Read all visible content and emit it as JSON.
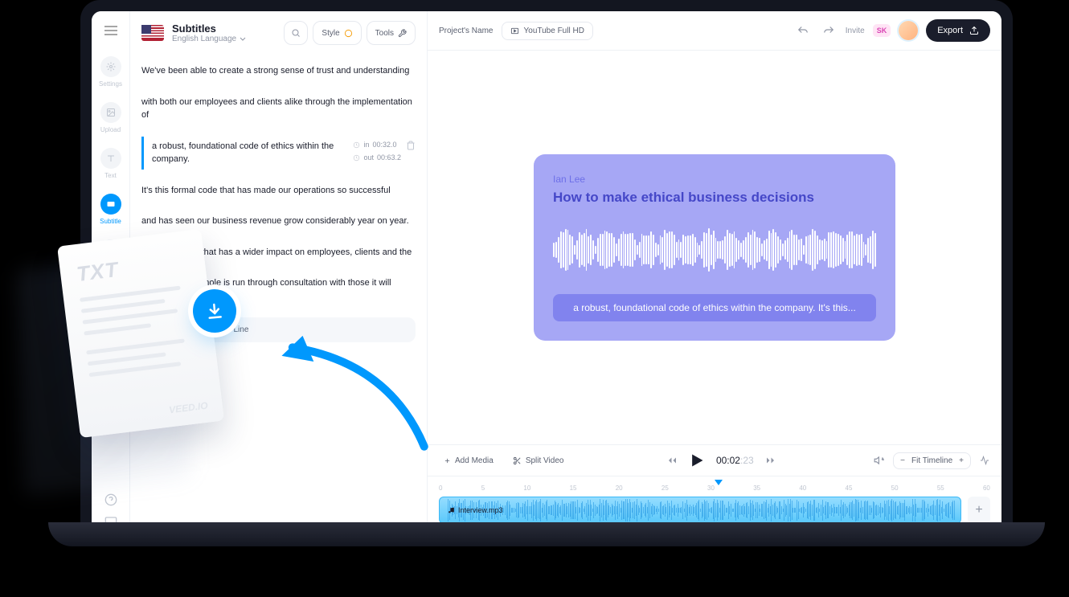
{
  "sidebar": {
    "items": [
      {
        "label": "Settings",
        "icon": "gear"
      },
      {
        "label": "Upload",
        "icon": "image"
      },
      {
        "label": "Text",
        "icon": "text"
      },
      {
        "label": "Subtitle",
        "icon": "subtitle",
        "active": true
      },
      {
        "label": "",
        "icon": "chat"
      }
    ]
  },
  "subtitles": {
    "title": "Subtitles",
    "language": "English Language",
    "style_btn": "Style",
    "tools_btn": "Tools",
    "lines": [
      "We've been able to create a strong sense of trust and understanding",
      "with both our employees and clients alike through the implementation of",
      "a robust, foundational code of ethics within the company.",
      "It's this formal code that has made our operations so successful",
      "and has seen our business revenue grow considerably year on year.",
      "Every decision that has a wider impact on employees, clients and the",
      "business as a whole is run through consultation with those it will effect."
    ],
    "selected_index": 2,
    "in_label": "in",
    "in_time": "00:32.0",
    "out_label": "out",
    "out_time": "00:63.2",
    "add_line": "Add New Subtitles Line"
  },
  "topbar": {
    "project": "Project's Name",
    "resolution": "YouTube Full HD",
    "invite": "Invite",
    "badge": "SK",
    "export": "Export"
  },
  "preview": {
    "speaker": "Ian Lee",
    "title": "How to make ethical business decisions",
    "caption": "a robust, foundational code of ethics within the company. It's this..."
  },
  "timeline": {
    "add_media": "Add Media",
    "split": "Split Video",
    "fit": "Fit Timeline",
    "time": "00:02",
    "time_ms": ":23",
    "ruler": [
      "0",
      "5",
      "10",
      "15",
      "20",
      "25",
      "30",
      "35",
      "40",
      "45",
      "50",
      "55",
      "60"
    ],
    "track_name": "Interview.mp3"
  },
  "txt": {
    "label": "TXT",
    "brand": "VEED.IO"
  }
}
